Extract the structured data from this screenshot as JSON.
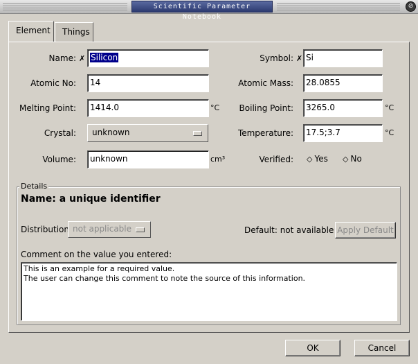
{
  "window": {
    "title": "Scientific Parameter Notebook",
    "close_icon": "close-icon"
  },
  "tabs": [
    {
      "label": "Element"
    },
    {
      "label": "Things"
    }
  ],
  "form": {
    "name": {
      "label": "Name:",
      "value": "Silicon",
      "required_mark": "✗"
    },
    "symbol": {
      "label": "Symbol:",
      "value": "Si",
      "required_mark": "✗"
    },
    "atomic_no": {
      "label": "Atomic No:",
      "value": "14"
    },
    "atomic_mass": {
      "label": "Atomic Mass:",
      "value": "28.0855"
    },
    "melting_point": {
      "label": "Melting Point:",
      "value": "1414.0",
      "unit": "°C"
    },
    "boiling_point": {
      "label": "Boiling Point:",
      "value": "3265.0",
      "unit": "°C"
    },
    "crystal": {
      "label": "Crystal:",
      "value": "unknown"
    },
    "temperature": {
      "label": "Temperature:",
      "value": "17.5;3.7",
      "unit": "°C"
    },
    "volume": {
      "label": "Volume:",
      "value": "unknown",
      "unit": "cm³"
    },
    "verified": {
      "label": "Verified:",
      "yes": "Yes",
      "no": "No"
    }
  },
  "details": {
    "group_title": "Details",
    "heading": "Name: a unique identifier",
    "distribution_label": "Distribution:",
    "distribution_value": "not applicable",
    "default_text": "Default: not available",
    "apply_default_label": "Apply Default",
    "comment_label": "Comment on the value you entered:",
    "comment_lines": [
      "This is an example for a required value.",
      "The user can change this comment to note the source of this information."
    ]
  },
  "buttons": {
    "ok": "OK",
    "cancel": "Cancel"
  }
}
